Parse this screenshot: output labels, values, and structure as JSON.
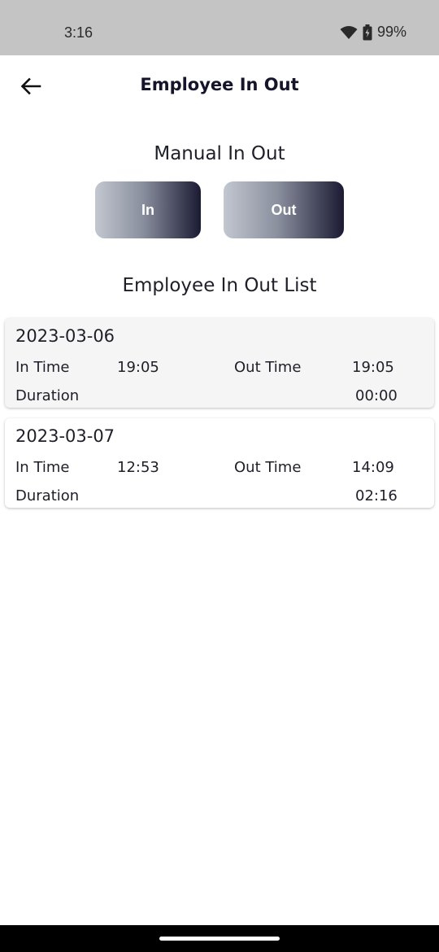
{
  "status": {
    "time": "3:16",
    "battery": "99%"
  },
  "header": {
    "title": "Employee In Out"
  },
  "manual": {
    "title": "Manual In Out",
    "in_label": "In",
    "out_label": "Out"
  },
  "list": {
    "title": "Employee In Out List",
    "entries": [
      {
        "date": "2023-03-06",
        "in_label": "In Time",
        "in_time": "19:05",
        "out_label": "Out Time",
        "out_time": "19:05",
        "duration_label": "Duration",
        "duration": "00:00"
      },
      {
        "date": "2023-03-07",
        "in_label": "In Time",
        "in_time": "12:53",
        "out_label": "Out Time",
        "out_time": "14:09",
        "duration_label": "Duration",
        "duration": "02:16"
      }
    ]
  },
  "icons": {
    "back": "arrow-back-icon",
    "wifi": "wifi-icon",
    "battery": "battery-icon"
  },
  "colors": {
    "button_gradient_start": "#c2c7d0",
    "button_gradient_end": "#1a1b33",
    "status_bar": "#c4c4c4"
  }
}
